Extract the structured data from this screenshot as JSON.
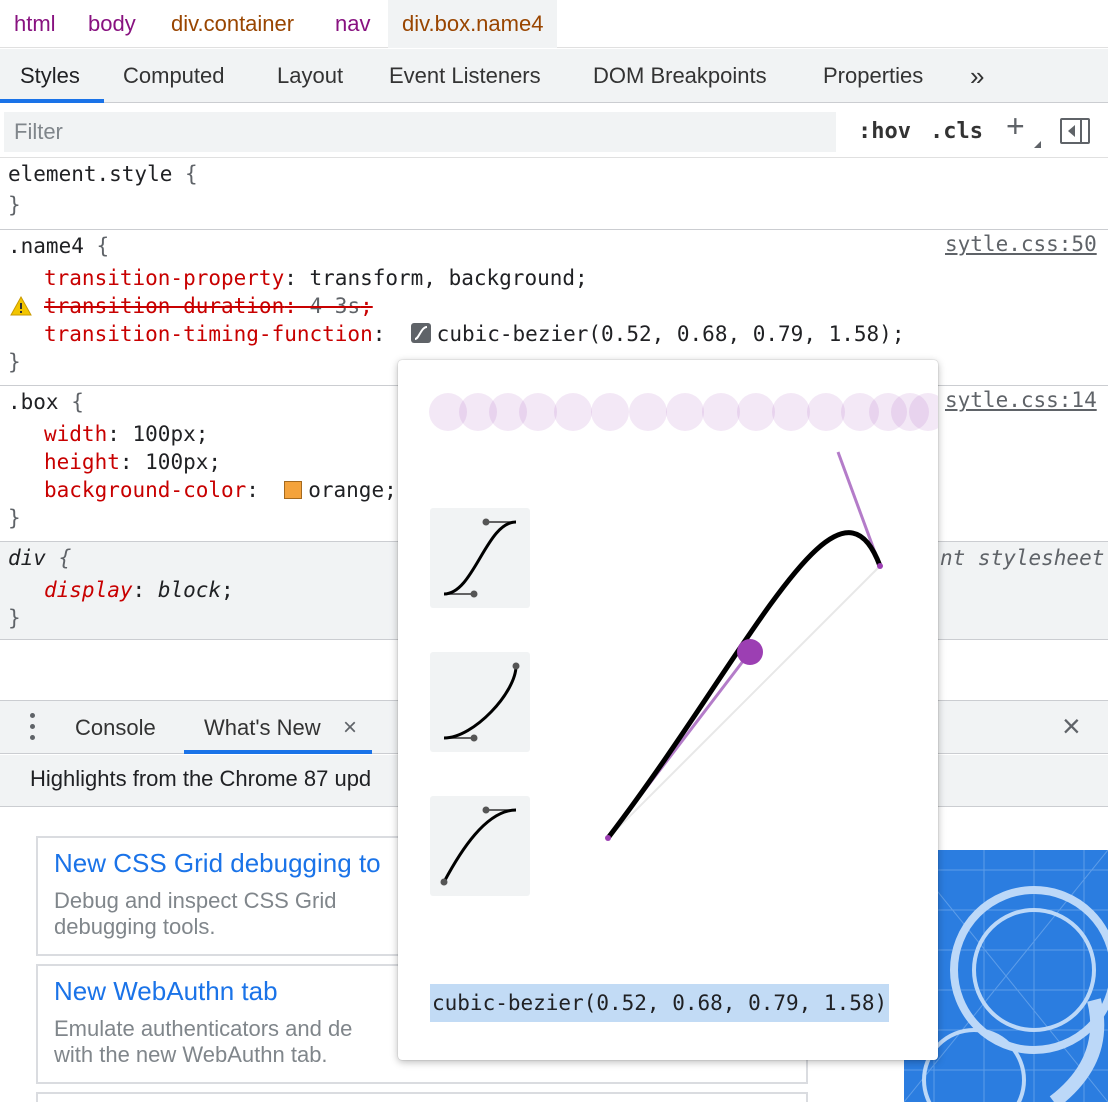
{
  "breadcrumb": [
    "html",
    "body",
    "div.container",
    "nav",
    "div.box.name4"
  ],
  "tabs": [
    "Styles",
    "Computed",
    "Layout",
    "Event Listeners",
    "DOM Breakpoints",
    "Properties",
    "»"
  ],
  "filter": {
    "placeholder": "Filter",
    "hov": ":hov",
    "cls": ".cls"
  },
  "rules": {
    "element_style": {
      "selector": "element.style",
      "open": " {",
      "close": "}"
    },
    "name4": {
      "selector": ".name4",
      "source": "sytle.css:50",
      "p1": "transition-property",
      "v1": "transform, background",
      "p2": "transition-duration",
      "v2": "4 3s",
      "p3": "transition-timing-function",
      "v3": "cubic-bezier(0.52, 0.68, 0.79, 1.58)"
    },
    "box": {
      "selector": ".box",
      "source": "sytle.css:14",
      "p1": "width",
      "v1": "100px",
      "p2": "height",
      "v2": "100px",
      "p3": "background-color",
      "v3": "orange"
    },
    "div": {
      "selector": "div",
      "source": "nt stylesheet",
      "p1": "display",
      "v1": "block"
    }
  },
  "drawer": {
    "tabs": [
      "Console",
      "What's New"
    ],
    "close_tab": "×",
    "close": "×",
    "highlight": "Highlights from the Chrome 87 upd",
    "cards": [
      {
        "title": "New CSS Grid debugging to",
        "desc1": "Debug and inspect CSS Grid",
        "desc2": "debugging tools."
      },
      {
        "title": "New WebAuthn tab",
        "desc1": "Emulate authenticators and de",
        "desc2": "with the new WebAuthn tab."
      }
    ]
  },
  "bezier_editor": {
    "value": "cubic-bezier(0.52, 0.68, 0.79, 1.58)",
    "control_points": [
      0.52,
      0.68,
      0.79,
      1.58
    ]
  },
  "colors": {
    "accent": "#1a73e8",
    "tag": "#881280",
    "attr": "#994500",
    "property": "#c80000",
    "bezier_purple": "#9c3fb3",
    "swatch_orange": "#f4a33c"
  }
}
